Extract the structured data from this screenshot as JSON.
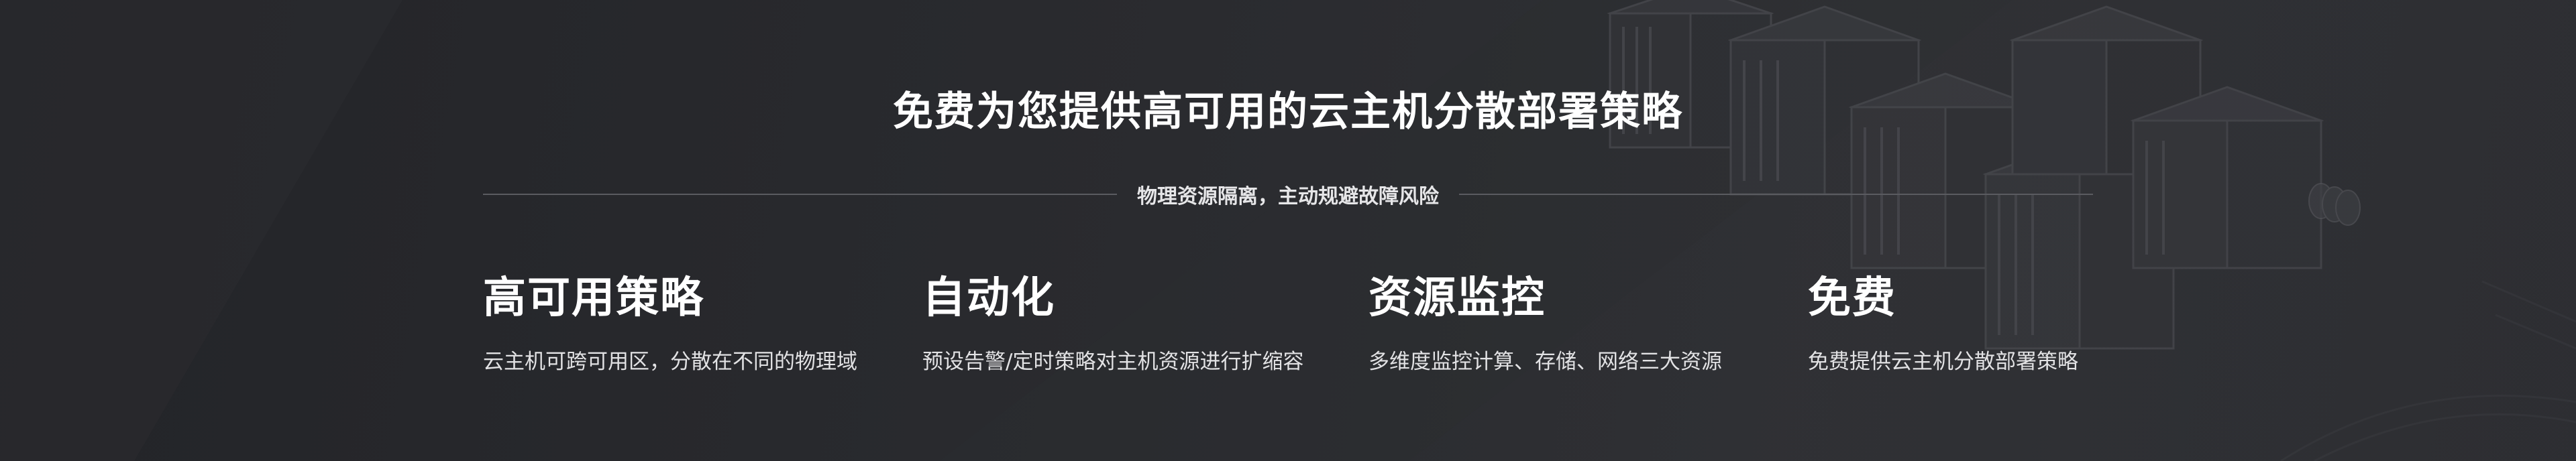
{
  "banner": {
    "title": "免费为您提供高可用的云主机分散部署策略",
    "subtitle": "物理资源隔离，主动规避故障风险"
  },
  "features": [
    {
      "title": "高可用策略",
      "desc": "云主机可跨可用区，分散在不同的物理域"
    },
    {
      "title": "自动化",
      "desc": "预设告警/定时策略对主机资源进行扩缩容"
    },
    {
      "title": "资源监控",
      "desc": "多维度监控计算、存储、网络三大资源"
    },
    {
      "title": "免费",
      "desc": "免费提供云主机分散部署策略"
    }
  ],
  "colors": {
    "background": "#26272b",
    "text": "#ffffff",
    "divider": "#5a5b60"
  }
}
